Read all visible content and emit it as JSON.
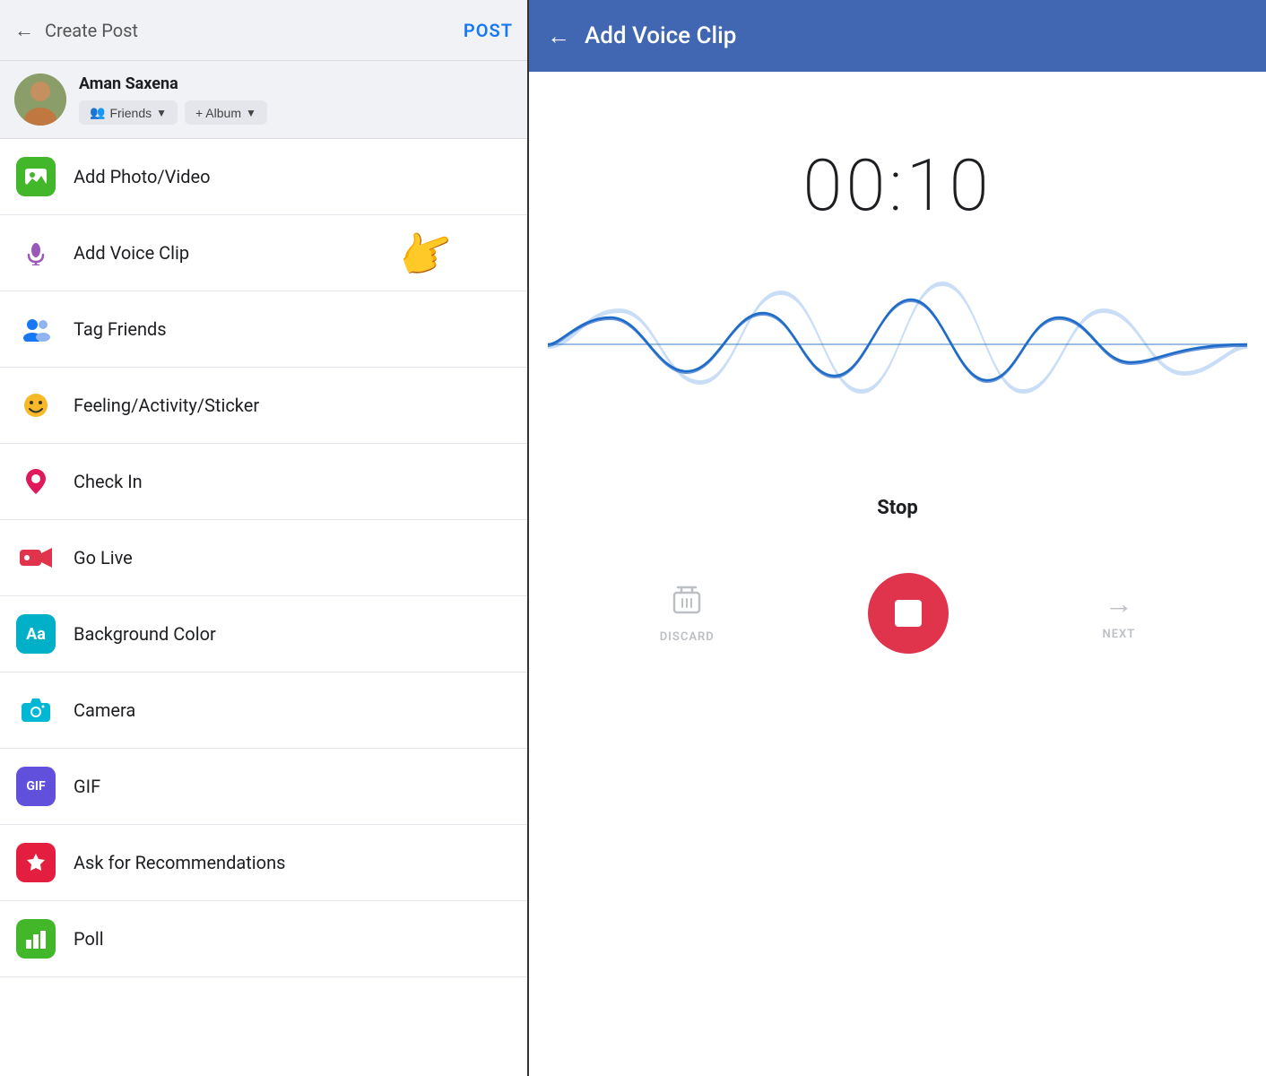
{
  "left": {
    "header": {
      "back_label": "←",
      "title": "Create Post",
      "post_btn": "POST"
    },
    "profile": {
      "name": "Aman Saxena",
      "friends_btn": "Friends",
      "album_btn": "+ Album"
    },
    "menu_items": [
      {
        "id": "photo-video",
        "label": "Add Photo/Video",
        "icon": "🖼️",
        "icon_bg": "green"
      },
      {
        "id": "voice-clip",
        "label": "Add Voice Clip",
        "icon": "🎤",
        "icon_bg": "purple",
        "has_pointer": true
      },
      {
        "id": "tag-friends",
        "label": "Tag Friends",
        "icon": "👥",
        "icon_bg": "blue"
      },
      {
        "id": "feeling",
        "label": "Feeling/Activity/Sticker",
        "icon": "😊",
        "icon_bg": "yellow"
      },
      {
        "id": "check-in",
        "label": "Check In",
        "icon": "📍",
        "icon_bg": "pink"
      },
      {
        "id": "go-live",
        "label": "Go Live",
        "icon": "🔴",
        "icon_bg": "red"
      },
      {
        "id": "bg-color",
        "label": "Background Color",
        "icon": "Aa",
        "icon_bg": "teal"
      },
      {
        "id": "camera",
        "label": "Camera",
        "icon": "📷",
        "icon_bg": "cyan"
      },
      {
        "id": "gif",
        "label": "GIF",
        "icon": "GIF",
        "icon_bg": "gif"
      },
      {
        "id": "recommendations",
        "label": "Ask for Recommendations",
        "icon": "⭐",
        "icon_bg": "red2"
      },
      {
        "id": "poll",
        "label": "Poll",
        "icon": "📊",
        "icon_bg": "limegreen"
      }
    ]
  },
  "right": {
    "header": {
      "back_label": "←",
      "title": "Add Voice Clip"
    },
    "timer": "00:10",
    "stop_label": "Stop",
    "controls": {
      "discard_label": "DISCARD",
      "next_label": "NEXT"
    }
  }
}
